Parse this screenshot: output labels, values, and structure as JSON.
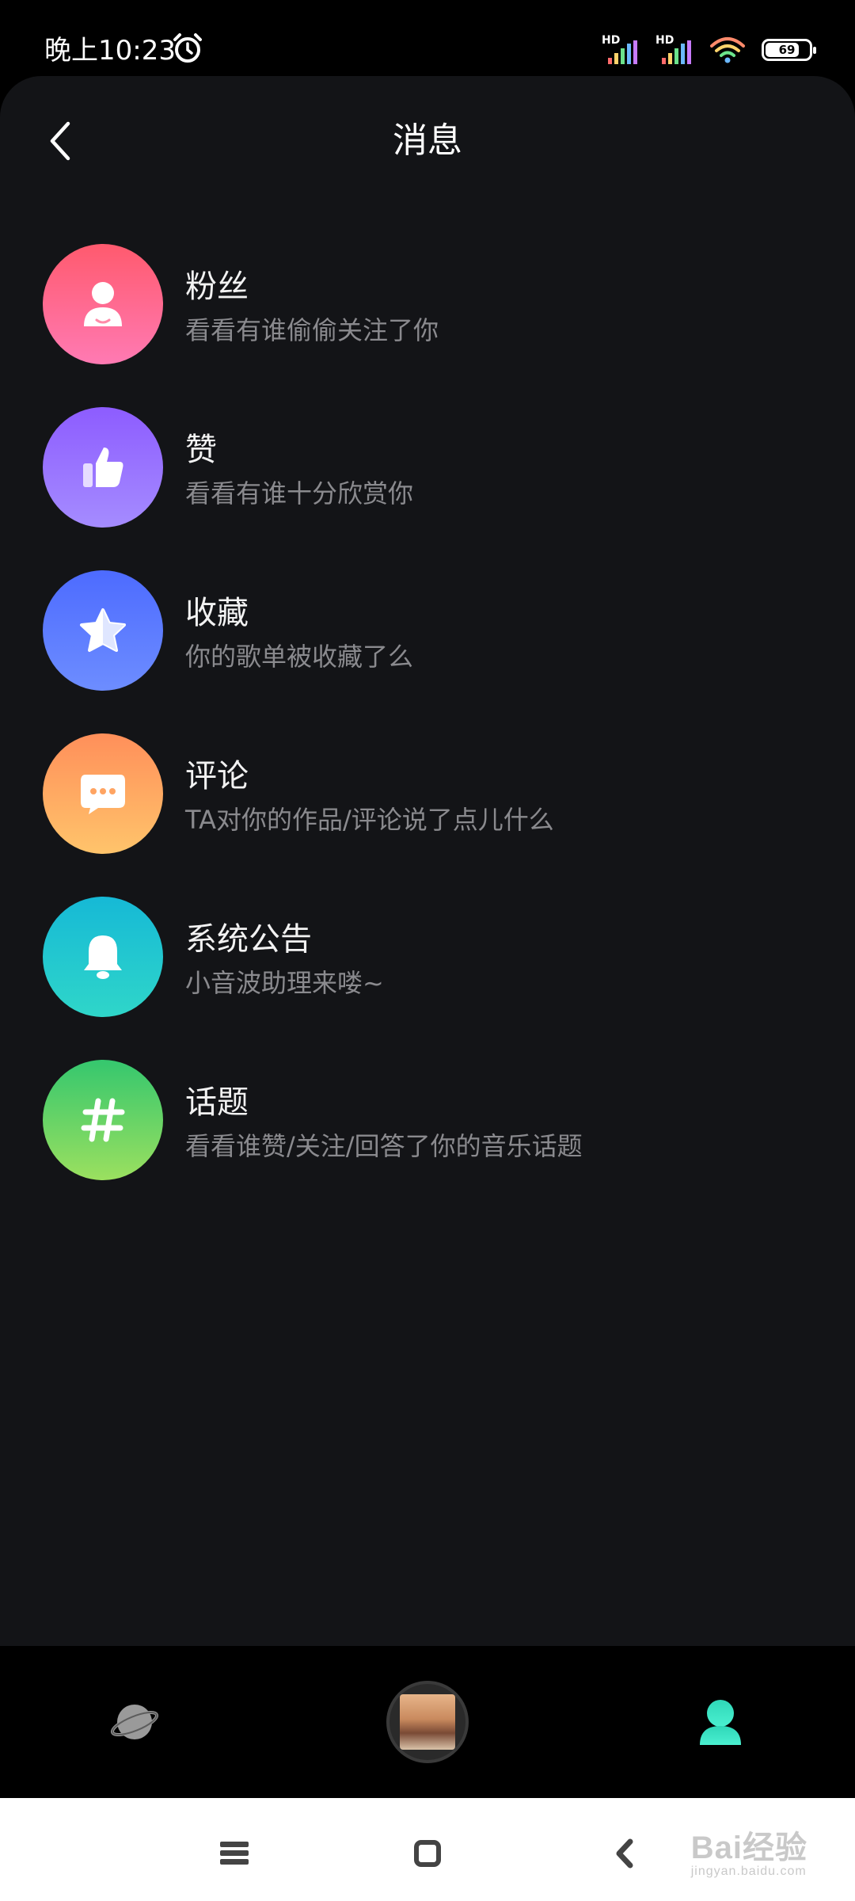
{
  "status_bar": {
    "time": "晚上10:23",
    "signal_label_1": "HD",
    "signal_label_2": "HD",
    "battery": "69"
  },
  "header": {
    "title": "消息"
  },
  "messages": [
    {
      "title": "粉丝",
      "subtitle": "看看有谁偷偷关注了你",
      "icon": "person-icon",
      "gradient": [
        "#ff5a6e",
        "#ff7ab3"
      ]
    },
    {
      "title": "赞",
      "subtitle": "看看有谁十分欣赏你",
      "icon": "thumbs-up-icon",
      "gradient": [
        "#8d5cff",
        "#a58cff"
      ]
    },
    {
      "title": "收藏",
      "subtitle": "你的歌单被收藏了么",
      "icon": "star-icon",
      "gradient": [
        "#4d6bff",
        "#6d8dff"
      ]
    },
    {
      "title": "评论",
      "subtitle": "TA对你的作品/评论说了点儿什么",
      "icon": "chat-bubble-icon",
      "gradient": [
        "#ff8f5a",
        "#ffc46b"
      ]
    },
    {
      "title": "系统公告",
      "subtitle": "小音波助理来喽~",
      "icon": "bell-icon",
      "gradient": [
        "#16b9d6",
        "#2fd6c9"
      ]
    },
    {
      "title": "话题",
      "subtitle": "看看谁赞/关注/回答了你的音乐话题",
      "icon": "hashtag-icon",
      "gradient": [
        "#35c76e",
        "#9be05f"
      ]
    }
  ],
  "tab_bar": {
    "tabs": [
      "discover-planet-icon",
      "now-playing-disc",
      "profile-icon"
    ],
    "active_color": "#3ee6c4"
  },
  "watermark": {
    "text": "Bai",
    "text2": "经验",
    "sub": "jingyan.baidu.com"
  }
}
